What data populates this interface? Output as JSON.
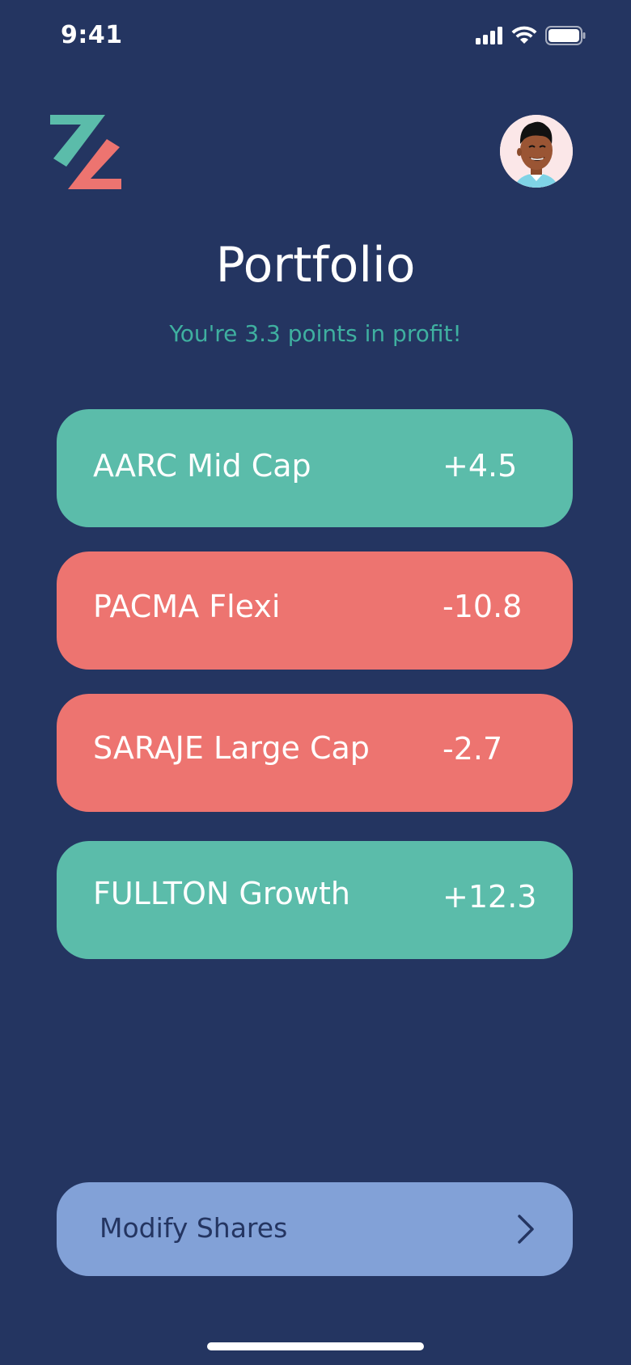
{
  "status_bar": {
    "time": "9:41"
  },
  "header": {
    "logo_icon": "zz-logo-icon",
    "avatar_icon": "user-avatar-icon"
  },
  "page": {
    "title": "Portfolio",
    "profit_message": "You're 3.3 points in profit!"
  },
  "funds": [
    {
      "name": "AARC Mid Cap",
      "change": "+4.5",
      "status": "positive"
    },
    {
      "name": "PACMA Flexi",
      "change": "-10.8",
      "status": "negative"
    },
    {
      "name": "SARAJE Large Cap",
      "change": "-2.7",
      "status": "negative"
    },
    {
      "name": "FULLTON Growth",
      "change": "+12.3",
      "status": "positive"
    }
  ],
  "actions": {
    "modify_label": "Modify Shares",
    "modify_icon": "chevron-right-icon"
  },
  "colors": {
    "background": "#243561",
    "positive": "#5bbcaa",
    "negative": "#ed7470",
    "profit_text": "#3fb0a0",
    "button": "#82a1d7"
  }
}
